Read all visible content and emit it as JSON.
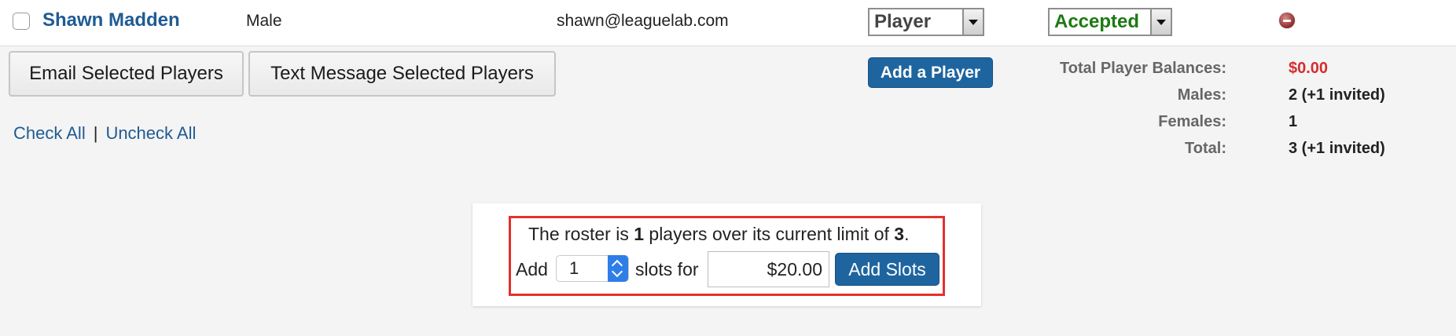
{
  "player_row": {
    "name": "Shawn Madden",
    "gender": "Male",
    "email": "shawn@leaguelab.com",
    "role": "Player",
    "status": "Accepted"
  },
  "actions": {
    "email_selected": "Email Selected Players",
    "text_selected": "Text Message Selected Players",
    "add_player": "Add a Player",
    "check_all": "Check All",
    "separator": "|",
    "uncheck_all": "Uncheck All"
  },
  "stats": {
    "balances_label": "Total Player Balances:",
    "balances_value": "$0.00",
    "males_label": "Males:",
    "males_value": "2 (+1 invited)",
    "females_label": "Females:",
    "females_value": "1",
    "total_label": "Total:",
    "total_value": "3 (+1 invited)"
  },
  "roster": {
    "msg_prefix": "The roster is ",
    "over_count": "1",
    "msg_middle": " players over its current limit of ",
    "limit": "3",
    "msg_suffix": ".",
    "add_label": "Add",
    "slots_value": "1",
    "slots_label": "slots for",
    "price": "$20.00",
    "add_slots_button": "Add Slots"
  }
}
